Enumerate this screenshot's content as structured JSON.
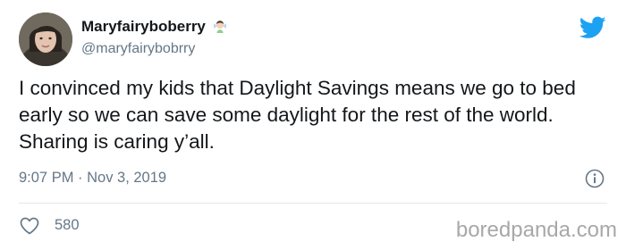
{
  "tweet": {
    "display_name": "Maryfairyboberry",
    "emoji": "woman-fairy-emoji",
    "handle": "@maryfairybobrry",
    "text": "I convinced my kids that Daylight Savings means we go to bed early so we can save some daylight for the rest of the world. Sharing is caring y’all.",
    "timestamp": "9:07 PM · Nov 3, 2019",
    "like_count": "580"
  },
  "watermark": "boredpanda.com",
  "icons": {
    "brand": "twitter-bird-icon",
    "info": "info-icon",
    "like": "heart-icon"
  },
  "colors": {
    "twitter_blue": "#1da1f2",
    "secondary_text": "#657786",
    "primary_text": "#14171a",
    "divider": "#e1e8ed",
    "watermark": "#a8a8a8"
  }
}
